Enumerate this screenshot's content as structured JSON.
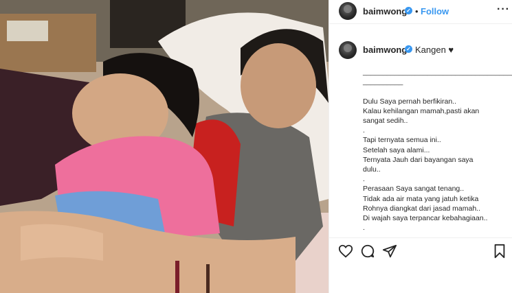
{
  "header": {
    "username": "baimwong",
    "verified_glyph": "✓",
    "separator": "•",
    "follow_label": "Follow",
    "more_icon": "more-horizontal-icon",
    "more_glyph": "···"
  },
  "caption": {
    "username": "baimwong",
    "text": "Kangen ♥",
    "lines": [
      "________________________________________",
      "__________",
      "",
      "Dulu Saya pernah berfikiran..",
      "Kalau kehilangan mamah,pasti akan",
      "sangat sedih..",
      ".",
      "Tapi ternyata semua ini..",
      "Setelah saya alami...",
      "Ternyata Jauh dari bayangan saya",
      "dulu..",
      ".",
      "Perasaan Saya sangat tenang..",
      "Tidak ada air mata yang jatuh ketika",
      "Rohnya diangkat dari jasad mamah..",
      "Di wajah saya terpancar kebahagiaan..",
      "."
    ]
  },
  "actions": {
    "icons": [
      "heart-icon",
      "comment-icon",
      "share-icon",
      "bookmark-icon"
    ]
  },
  "colors": {
    "accent": "#3897f0",
    "text": "#262626",
    "border": "#efefef"
  }
}
